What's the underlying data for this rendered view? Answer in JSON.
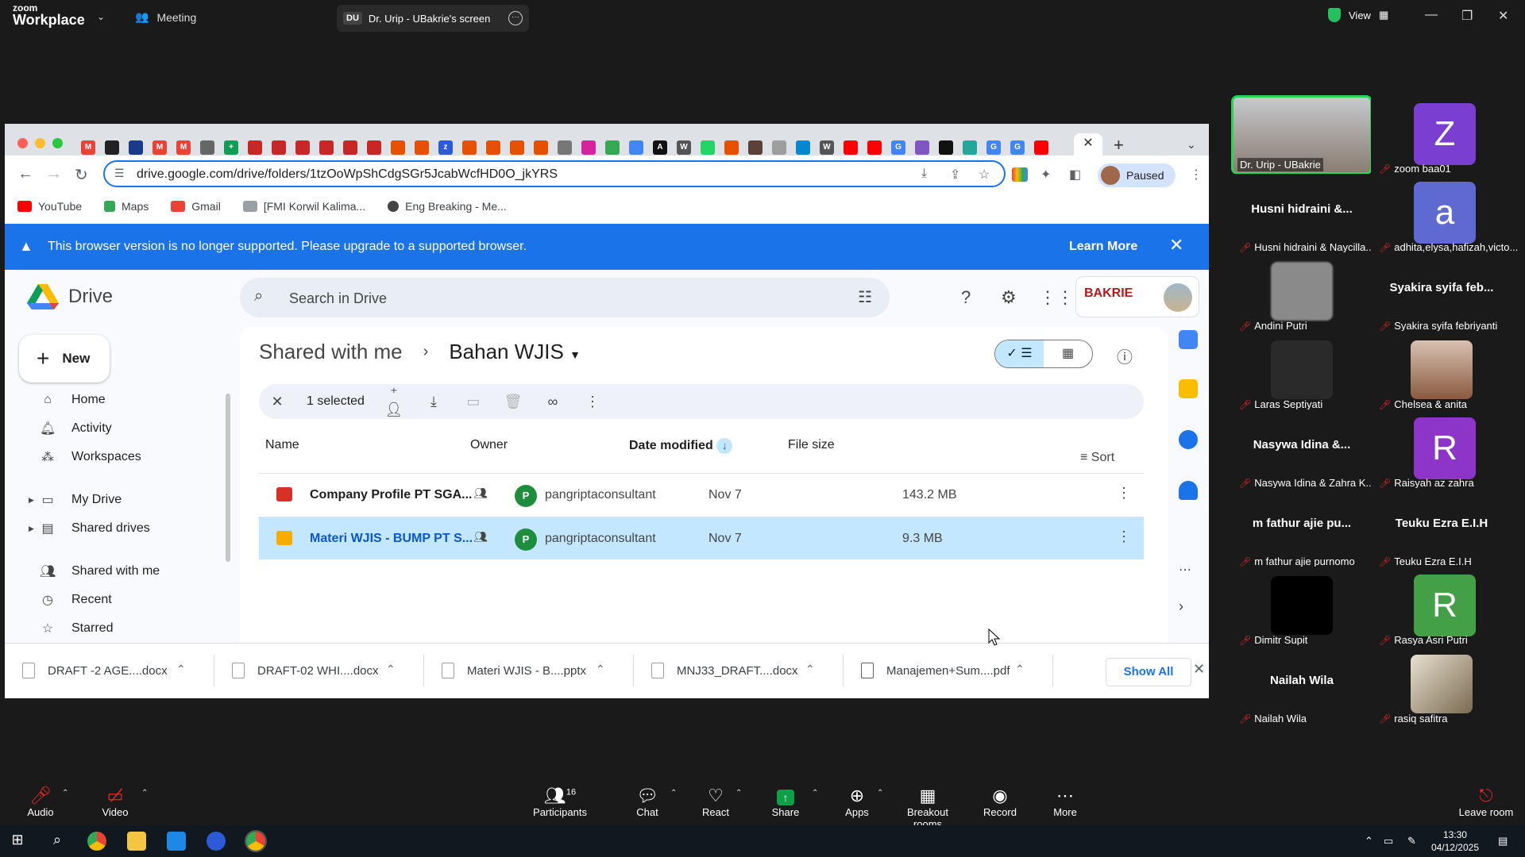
{
  "zoom": {
    "brand_small": "zoom",
    "brand_big": "Workplace",
    "meeting_tab": "Meeting",
    "screen_badge": "DU",
    "screen_tab": "Dr. Urip - UBakrie's screen",
    "view_label": "View"
  },
  "browser": {
    "url": "drive.google.com/drive/folders/1tzOoWpShCdgSGr5JcabWcfHD0O_jkYRS",
    "paused_label": "Paused",
    "bookmarks": [
      "YouTube",
      "Maps",
      "Gmail",
      "[FMI Korwil Kalima...",
      "Eng Breaking - Me..."
    ],
    "colors": {
      "accent": "#1a73e8",
      "tab_strip": "#dee1e6"
    }
  },
  "banner": {
    "message": "This browser version is no longer supported. Please upgrade to a supported browser.",
    "learn_more": "Learn More"
  },
  "drive": {
    "app_name": "Drive",
    "search_placeholder": "Search in Drive",
    "new_label": "New",
    "nav": [
      "Home",
      "Activity",
      "Workspaces",
      "My Drive",
      "Shared drives",
      "Shared with me",
      "Recent",
      "Starred"
    ],
    "breadcrumb_parent": "Shared with me",
    "breadcrumb_current": "Bahan WJIS",
    "selected_label": "1 selected",
    "columns": [
      "Name",
      "Owner",
      "Date modified",
      "File size"
    ],
    "sort_label": "Sort",
    "files": [
      {
        "name": "Company Profile PT SGA...",
        "owner_initial": "P",
        "owner": "pangriptaconsultant",
        "date": "Nov 7",
        "size": "143.2 MB",
        "selected": false
      },
      {
        "name": "Materi WJIS - BUMP PT S...",
        "owner_initial": "P",
        "owner": "pangriptaconsultant",
        "date": "Nov 7",
        "size": "9.3 MB",
        "selected": true
      }
    ],
    "org_logo": "BAKRIE"
  },
  "downloads": {
    "items": [
      "DRAFT -2 AGE....docx",
      "DRAFT-02 WHI....docx",
      "Materi WJIS - B....pptx",
      "MNJ33_DRAFT....docx",
      "Manajemen+Sum....pdf"
    ],
    "show_all": "Show All"
  },
  "participants": [
    {
      "name": "Dr. Urip - UBakrie",
      "big": ""
    },
    {
      "name": "zoom baa01",
      "big": "",
      "letter": "Z"
    },
    {
      "name": "Husni hidraini & Naycilla...",
      "big": "Husni hidraini &..."
    },
    {
      "name": "adhita,elysa,hafizah,victo...",
      "big": "",
      "letter": "a"
    },
    {
      "name": "Andini Putri",
      "big": ""
    },
    {
      "name": "Syakira syifa febriyanti",
      "big": "Syakira syifa feb..."
    },
    {
      "name": "Laras Septiyati",
      "big": ""
    },
    {
      "name": "Chelsea & anita",
      "big": ""
    },
    {
      "name": "Nasywa Idina & Zahra K...",
      "big": "Nasywa Idina &..."
    },
    {
      "name": "Raisyah az zahra",
      "big": "",
      "letter": "R"
    },
    {
      "name": "m fathur ajie purnomo",
      "big": "m fathur ajie pu..."
    },
    {
      "name": "Teuku Ezra E.I.H",
      "big": "Teuku Ezra E.I.H"
    },
    {
      "name": "Dimitr Supit",
      "big": ""
    },
    {
      "name": "Rasya Asri Putri",
      "big": "",
      "letter": "R"
    },
    {
      "name": "Nailah Wila",
      "big": "Nailah Wila"
    },
    {
      "name": "rasiq safitra",
      "big": ""
    }
  ],
  "controls": {
    "audio": "Audio",
    "video": "Video",
    "participants": "Participants",
    "participants_count": "16",
    "chat": "Chat",
    "react": "React",
    "share": "Share",
    "apps": "Apps",
    "breakout": "Breakout rooms",
    "record": "Record",
    "more": "More",
    "leave": "Leave room"
  },
  "taskbar": {
    "time": "13:30",
    "date": "04/12/2025"
  }
}
